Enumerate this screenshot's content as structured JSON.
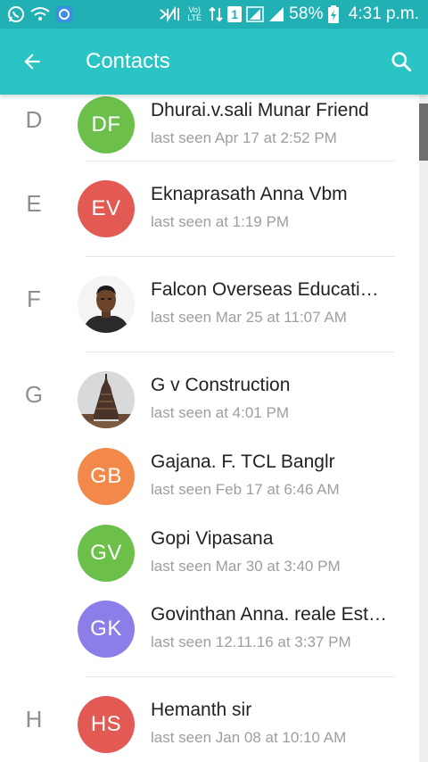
{
  "status_bar": {
    "battery": "58%",
    "time": "4:31 p.m.",
    "sim_label": "1",
    "volte_label": "Vo) LTE",
    "colors": {
      "background": "#21b1b5"
    }
  },
  "app_bar": {
    "title": "Contacts",
    "back_icon": "arrow-left-icon",
    "search_icon": "search-icon",
    "colors": {
      "background": "#2bc4c4"
    }
  },
  "contacts": [
    {
      "section": "D",
      "initials": "DF",
      "name": "Dhurai.v.sali Munar Friend",
      "status": "last seen Apr 17 at 2:52 PM",
      "avatar_color": "#6cc04a"
    },
    {
      "section": "E",
      "initials": "EV",
      "name": "Eknaprasath Anna Vbm",
      "status": "last seen at 1:19 PM",
      "avatar_color": "#e35a54"
    },
    {
      "section": "F",
      "initials": "",
      "name": "Falcon Overseas Educati…",
      "status": "last seen Mar 25 at 11:07 AM",
      "avatar_color": "#f4f4f4",
      "avatar_kind": "photo-person"
    },
    {
      "section": "G",
      "initials": "",
      "name": "G v Construction",
      "status": "last seen at 4:01 PM",
      "avatar_color": "#dcdcdc",
      "avatar_kind": "photo-temple"
    },
    {
      "section": "",
      "initials": "GB",
      "name": "Gajana. F. TCL Banglr",
      "status": "last seen Feb 17 at 6:46 AM",
      "avatar_color": "#f2894b"
    },
    {
      "section": "",
      "initials": "GV",
      "name": "Gopi Vipasana",
      "status": "last seen Mar 30 at 3:40 PM",
      "avatar_color": "#6cc04a"
    },
    {
      "section": "",
      "initials": "GK",
      "name": "Govinthan Anna. reale Est…",
      "status": "last seen 12.11.16 at 3:37 PM",
      "avatar_color": "#8b7ee8"
    },
    {
      "section": "H",
      "initials": "HS",
      "name": "Hemanth sir",
      "status": "last seen Jan 08 at 10:10 AM",
      "avatar_color": "#e35a54"
    }
  ]
}
